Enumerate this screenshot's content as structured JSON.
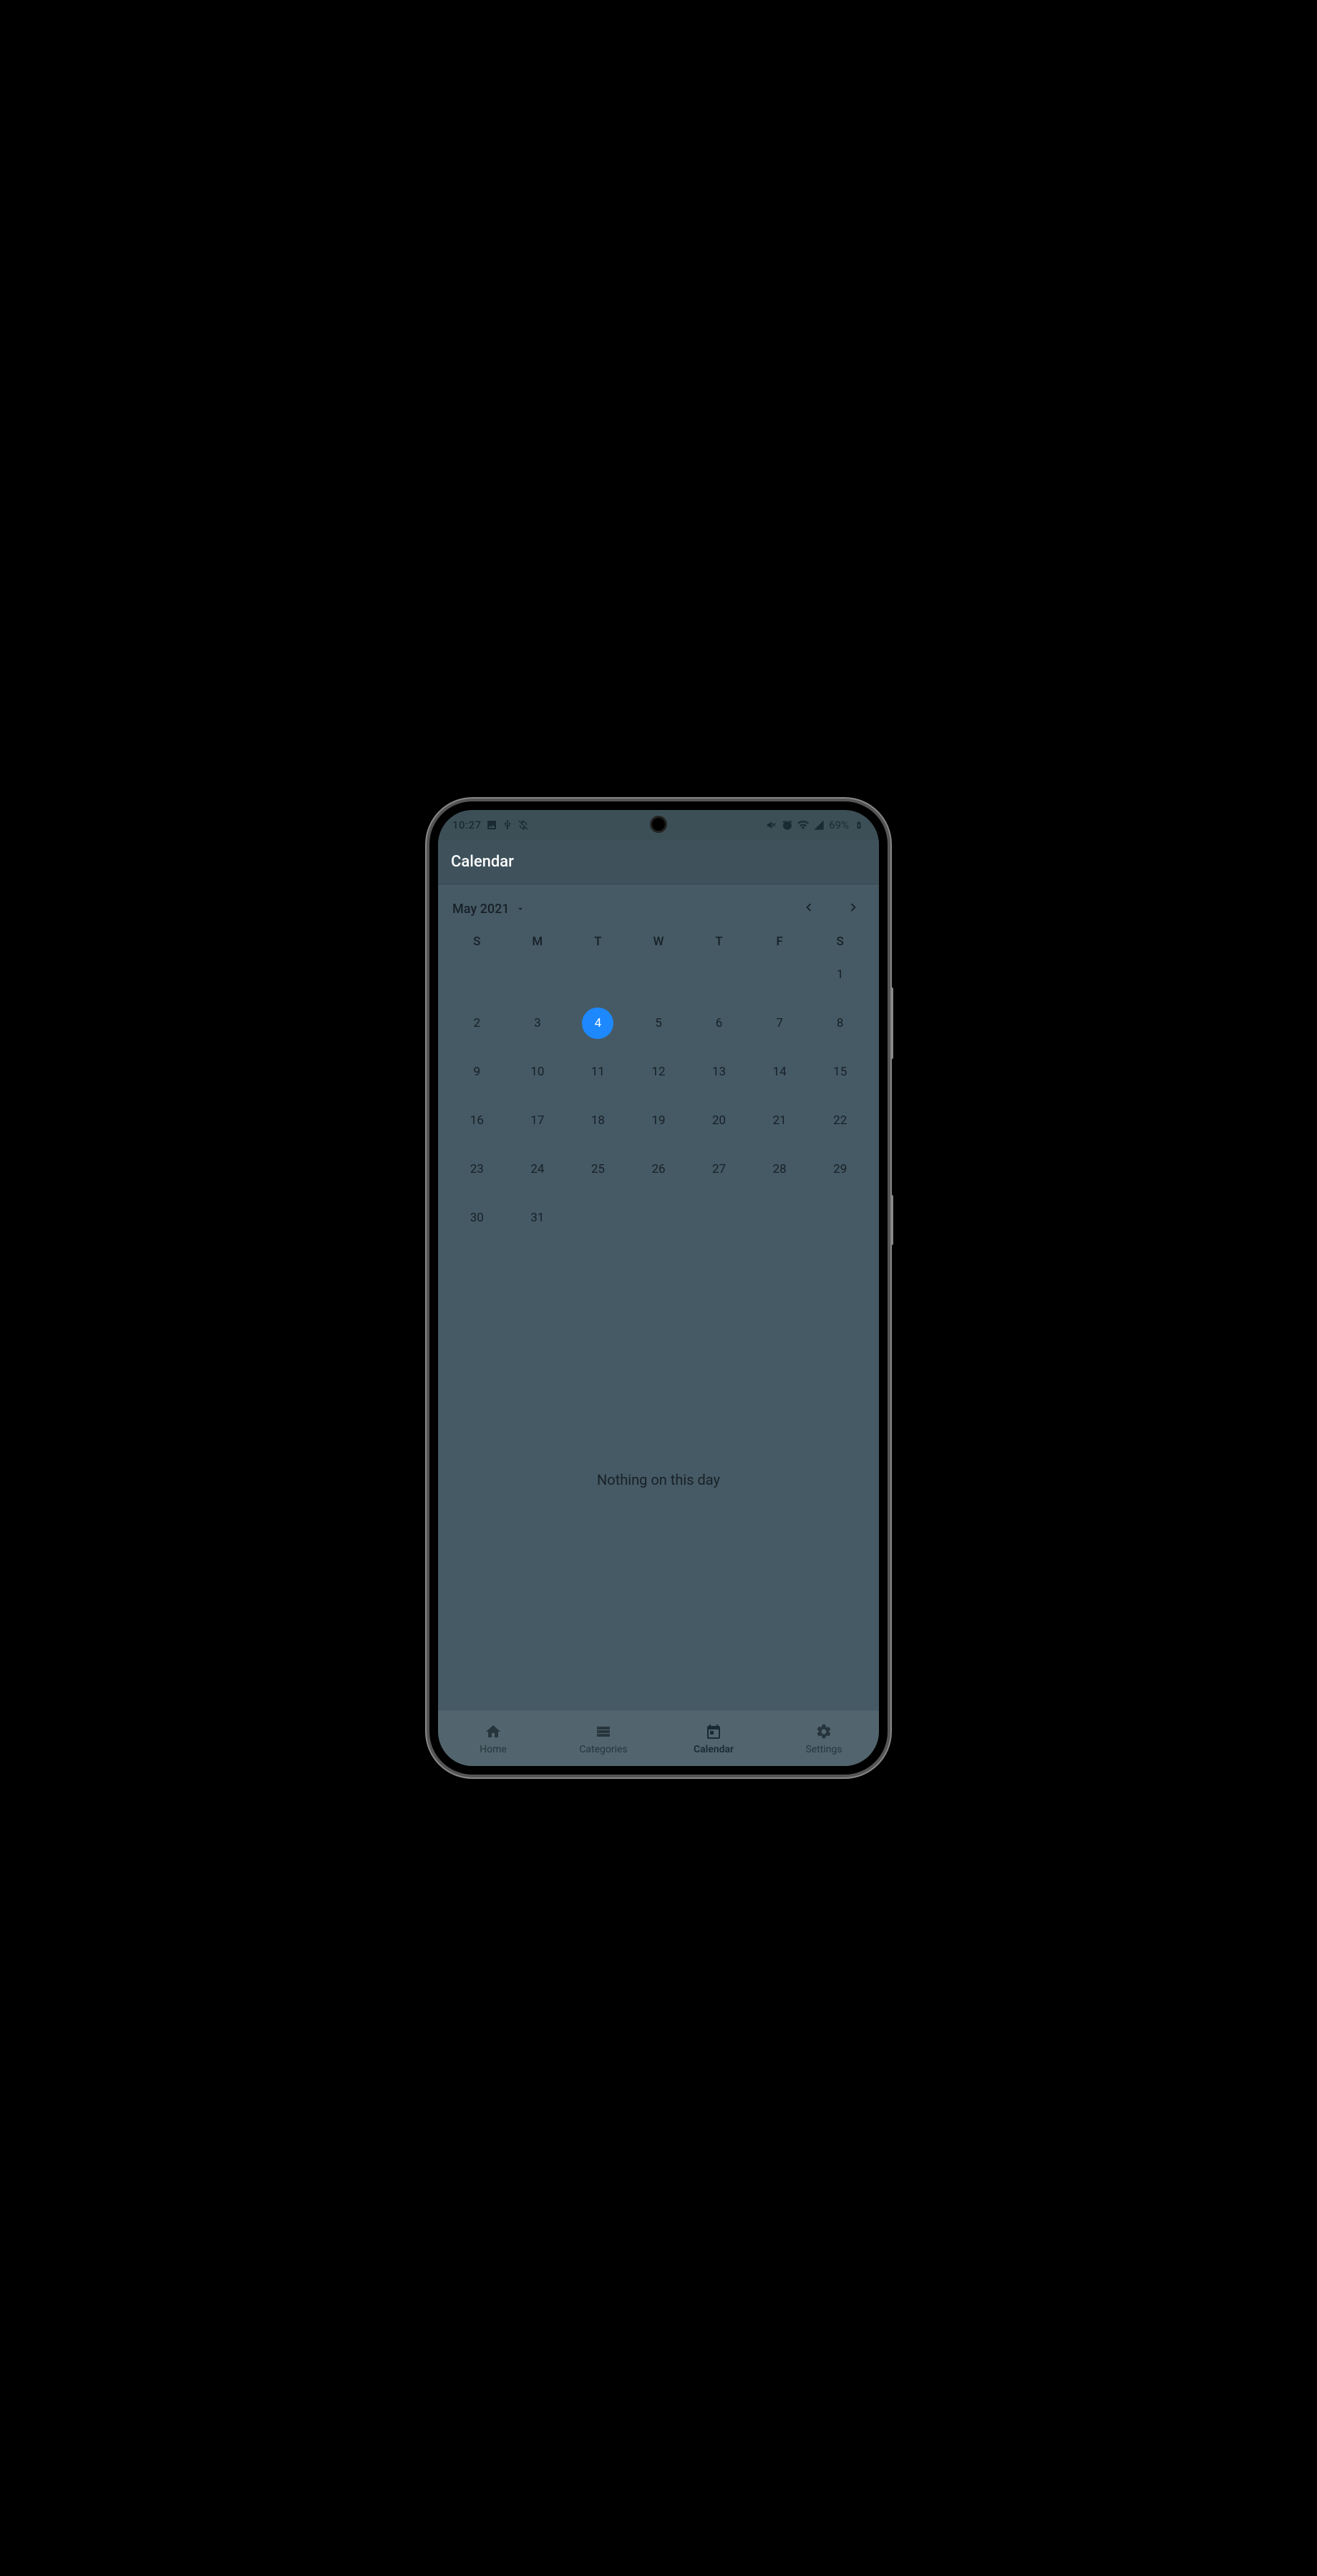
{
  "status": {
    "time": "10:27",
    "battery_text": "69%"
  },
  "app": {
    "title": "Calendar"
  },
  "month_picker": {
    "label": "May 2021"
  },
  "weekdays": [
    "S",
    "M",
    "T",
    "W",
    "T",
    "F",
    "S"
  ],
  "days": {
    "leading_blanks": 6,
    "count": 31,
    "selected": 4
  },
  "empty_message": "Nothing on this day",
  "nav": {
    "items": [
      {
        "label": "Home",
        "active": false
      },
      {
        "label": "Categories",
        "active": false
      },
      {
        "label": "Calendar",
        "active": true
      },
      {
        "label": "Settings",
        "active": false
      }
    ]
  },
  "colors": {
    "accent": "#1e88ff"
  }
}
